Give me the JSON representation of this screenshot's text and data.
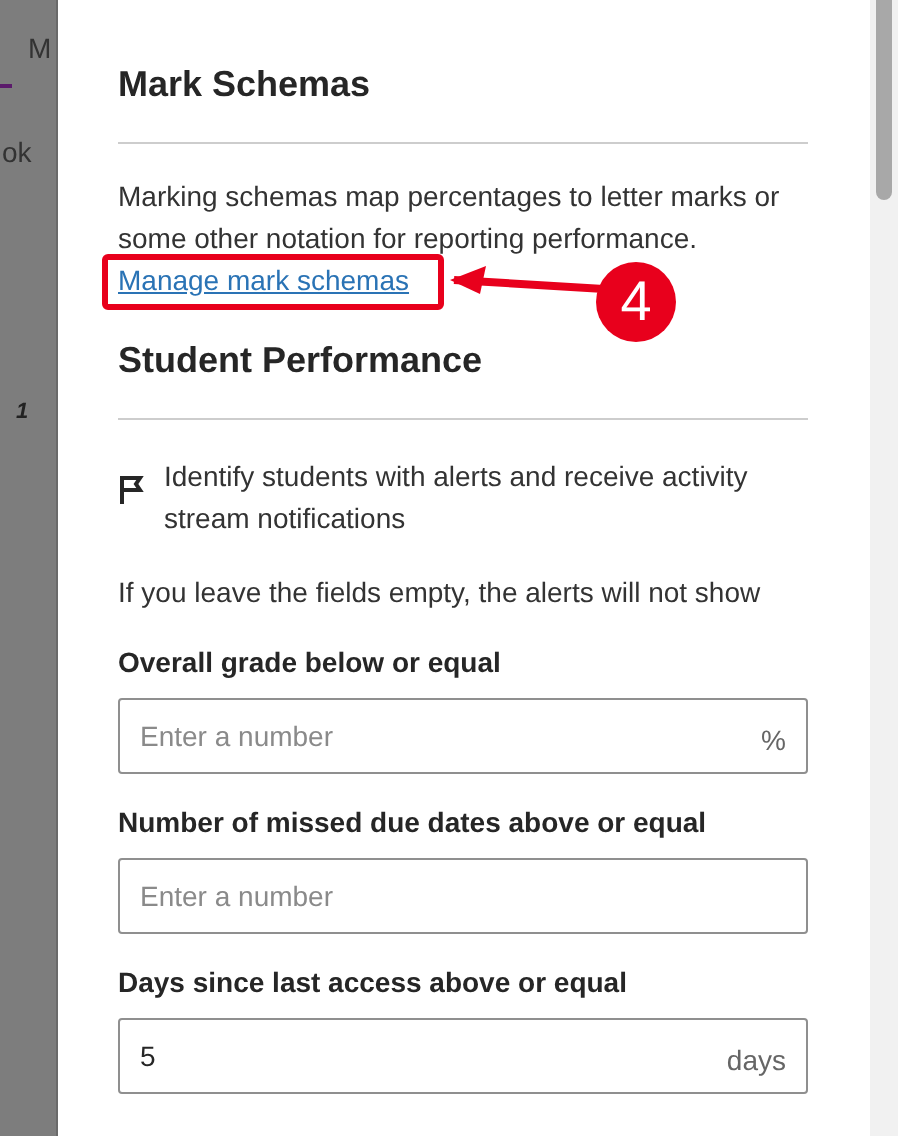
{
  "background": {
    "texts": [
      "M",
      "ok",
      "1"
    ]
  },
  "mark_schemas": {
    "title": "Mark Schemas",
    "description": "Marking schemas map percentages to letter marks or some other notation for reporting performance.",
    "link": "Manage mark schemas"
  },
  "callout": {
    "number": "4"
  },
  "student_performance": {
    "title": "Student Performance",
    "alert_option": "Identify students with alerts and receive activity stream notifications",
    "info": "If you leave the fields empty, the alerts will not show",
    "fields": [
      {
        "label": "Overall grade below or equal",
        "placeholder": "Enter a number",
        "suffix": "%"
      },
      {
        "label": "Number of missed due dates above or equal",
        "placeholder": "Enter a number"
      },
      {
        "label": "Days since last access above or equal",
        "value": "5",
        "suffix": "days"
      }
    ]
  }
}
